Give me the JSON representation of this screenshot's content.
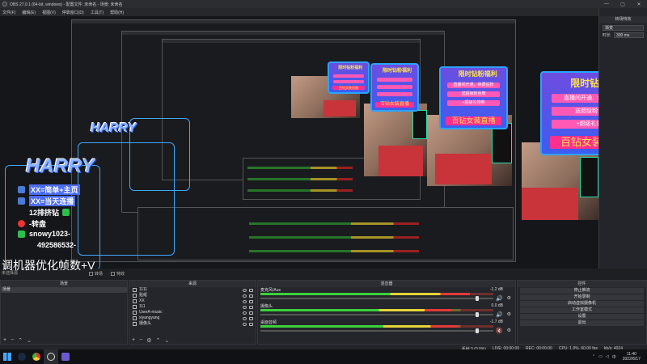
{
  "window": {
    "title": "OBS 27.0.1 (64-bit, windows) - 配置文件: 未命名 - 场景: 未命名"
  },
  "menu": [
    "文件(F)",
    "编辑(E)",
    "视图(V)",
    "停靠窗口(D)",
    "工具(T)",
    "帮助(H)"
  ],
  "overlay": {
    "logo_text": "HARRY",
    "lines": [
      "XX=简单+主页",
      "XX=当天连播",
      "12排挤钻",
      "-转盘",
      "snowy1023-",
      "492586532-"
    ],
    "big_text": "调机器优化帧数+V",
    "under_text": "未选择源"
  },
  "promo": {
    "title": "限时钻粉福利",
    "line1": "直播间开通，续费钻粉",
    "line2": "送超级粉丝牌",
    "line3": "+超级礼物券",
    "bottom": "百钻女装直播"
  },
  "right_panel": {
    "header": "转场特效",
    "transition": "渐变",
    "duration_label": "时长",
    "duration_value": "300 ms"
  },
  "transition_bar": {
    "label1": "转场",
    "label2": "特效"
  },
  "scenes": {
    "header": "场景",
    "items": [
      "场景"
    ]
  },
  "sources": {
    "header": "来源",
    "items": [
      {
        "name": "1111",
        "icon": "text-icon"
      },
      {
        "name": "贴纸",
        "icon": "image-icon"
      },
      {
        "name": "XX",
        "icon": "image-icon"
      },
      {
        "name": "111",
        "icon": "text-icon"
      },
      {
        "name": "UserA-music",
        "icon": "text-icon"
      },
      {
        "name": "xiyangyang",
        "icon": "image-icon"
      },
      {
        "name": "摄像头",
        "icon": "camera-icon"
      }
    ]
  },
  "mixer": {
    "header": "混音器",
    "tracks": [
      {
        "name": "麦克风/Aux",
        "db": "-1.2 dB",
        "level": 0.9,
        "volume": 0.93,
        "muted": false
      },
      {
        "name": "摄像头",
        "db": "0.0 dB",
        "level": 0.82,
        "volume": 0.93,
        "muted": false
      },
      {
        "name": "桌面音频",
        "db": "-1.7 dB",
        "level": 0.85,
        "volume": 0.93,
        "muted": true
      }
    ]
  },
  "controls": {
    "header": "控件",
    "buttons": [
      "停止推流",
      "开始录制",
      "启动虚拟摄像机",
      "工作室模式",
      "设置",
      "退出"
    ]
  },
  "status": {
    "dropped": "丢帧 0 (0.0%)",
    "live": "LIVE: 00:00:00",
    "rec": "REC: 00:00:00",
    "cpu": "CPU: 1.9%, 60.00 fps",
    "kbps": "kb/s: 4024"
  },
  "taskbar": {
    "time": "11:40",
    "date": "2022/6/17",
    "lang": "中"
  }
}
